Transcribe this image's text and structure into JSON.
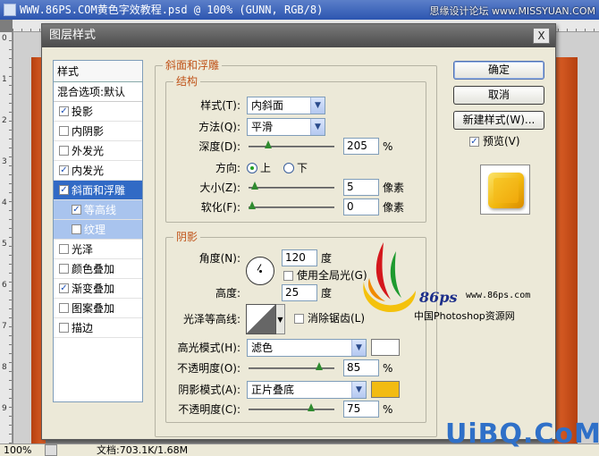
{
  "ps": {
    "title": "WWW.86PS.COM黄色字效教程.psd @ 100% (GUNN, RGB/8)",
    "watermark_top": "思缘设计论坛 www.MISSYUAN.COM",
    "ruler_left": [
      "0",
      "1",
      "2",
      "3",
      "4",
      "5",
      "6",
      "7",
      "8",
      "9"
    ],
    "status_zoom": "100%",
    "status_doc": "文档:703.1K/1.68M"
  },
  "dialog": {
    "title": "图层样式",
    "close": "X"
  },
  "styles": {
    "header": "样式",
    "blend": "混合选项:默认",
    "items": [
      {
        "label": "投影",
        "checked": true
      },
      {
        "label": "内阴影",
        "checked": false
      },
      {
        "label": "外发光",
        "checked": false
      },
      {
        "label": "内发光",
        "checked": true
      },
      {
        "label": "斜面和浮雕",
        "checked": true,
        "selected": true
      },
      {
        "label": "等高线",
        "checked": true,
        "sub": true
      },
      {
        "label": "纹理",
        "checked": false,
        "sub": true
      },
      {
        "label": "光泽",
        "checked": false
      },
      {
        "label": "颜色叠加",
        "checked": false
      },
      {
        "label": "渐变叠加",
        "checked": true
      },
      {
        "label": "图案叠加",
        "checked": false
      },
      {
        "label": "描边",
        "checked": false
      }
    ]
  },
  "bevel": {
    "legend": "斜面和浮雕",
    "structure_legend": "结构",
    "style_label": "样式(T):",
    "style_value": "内斜面",
    "technique_label": "方法(Q):",
    "technique_value": "平滑",
    "depth_label": "深度(D):",
    "depth_value": "205",
    "depth_unit": "%",
    "depth_frac": 0.2,
    "direction_label": "方向:",
    "dir_up": "上",
    "dir_down": "下",
    "size_label": "大小(Z):",
    "size_value": "5",
    "size_unit": "像素",
    "size_frac": 0.03,
    "soften_label": "软化(F):",
    "soften_value": "0",
    "soften_unit": "像素",
    "soften_frac": 0.0
  },
  "shading": {
    "legend": "阴影",
    "angle_label": "角度(N):",
    "angle_value": "120",
    "angle_unit": "度",
    "global_light_label": "使用全局光(G)",
    "altitude_label": "高度:",
    "altitude_value": "25",
    "altitude_unit": "度",
    "gloss_label": "光泽等高线:",
    "antialias_label": "消除锯齿(L)",
    "highlight_mode_label": "高光模式(H):",
    "highlight_mode_value": "滤色",
    "highlight_color": "#ffffff",
    "highlight_opacity_label": "不透明度(O):",
    "highlight_opacity_value": "85",
    "highlight_opacity_unit": "%",
    "highlight_opacity_frac": 0.85,
    "shadow_mode_label": "阴影模式(A):",
    "shadow_mode_value": "正片叠底",
    "shadow_color": "#f2bb12",
    "shadow_opacity_label": "不透明度(C):",
    "shadow_opacity_value": "75",
    "shadow_opacity_unit": "%",
    "shadow_opacity_frac": 0.75
  },
  "buttons": {
    "ok": "确定",
    "cancel": "取消",
    "new_style": "新建样式(W)...",
    "preview": "预览(V)"
  },
  "logo": {
    "brand": "86ps",
    "url": "www.86ps.com",
    "cn": "中国Photoshop资源网"
  },
  "watermark_bottom": "UiBQ.CoM"
}
